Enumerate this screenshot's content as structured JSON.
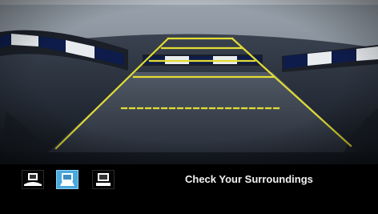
{
  "camera_view": {
    "guide_line_color": "#e2dc35",
    "mode": "rear-view-camera"
  },
  "view_modes": [
    {
      "name": "wide-view",
      "icon": "wide-view-icon",
      "active": false
    },
    {
      "name": "normal-view",
      "icon": "normal-view-icon",
      "active": true
    },
    {
      "name": "top-down-view",
      "icon": "top-down-view-icon",
      "active": false
    }
  ],
  "status": {
    "message": "Check Your Surroundings"
  },
  "colors": {
    "active_button": "#49a8dd",
    "background": "#000000"
  }
}
